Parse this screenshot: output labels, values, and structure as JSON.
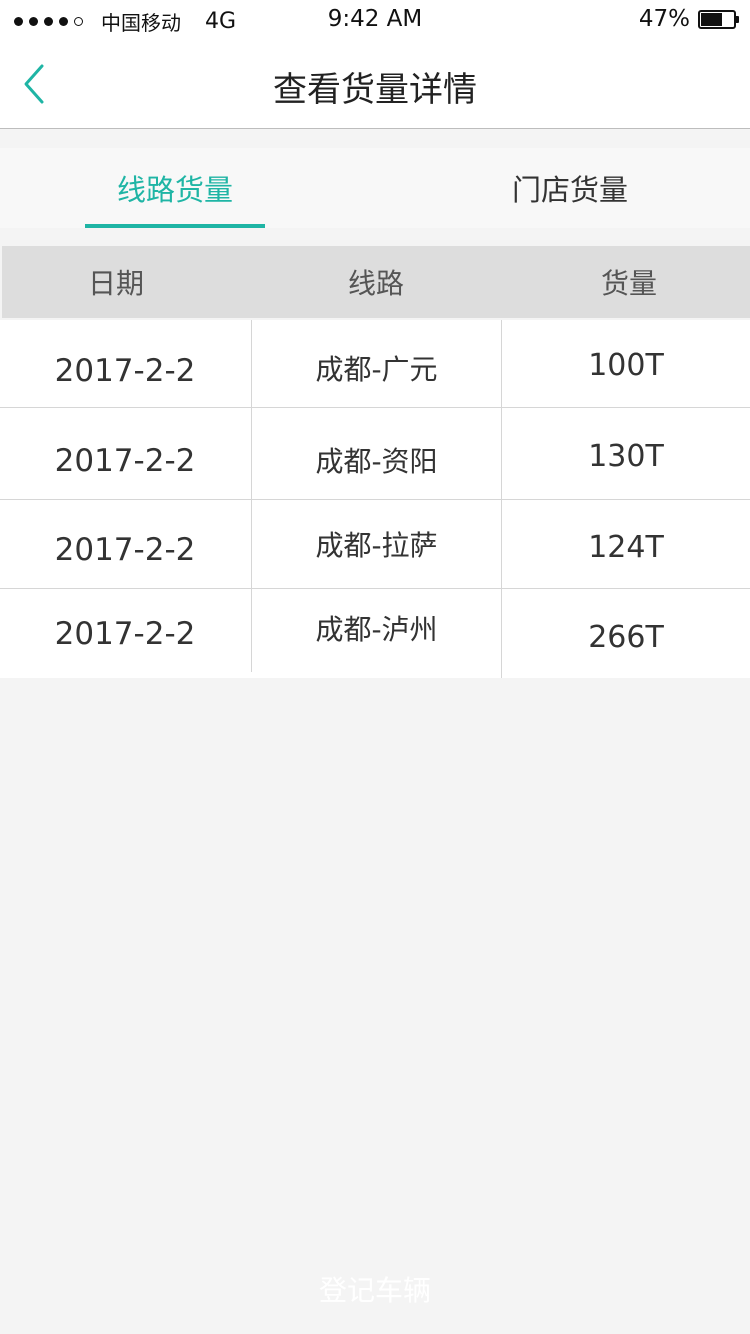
{
  "status_bar": {
    "carrier": "中国移动",
    "network": "4G",
    "time": "9:42 AM",
    "battery_percent": "47%",
    "battery_level": 0.47,
    "signal_strength": 4
  },
  "nav": {
    "title": "查看货量详情",
    "back_icon": "chevron-left-icon",
    "accent_color": "#1fb5a5"
  },
  "tabs": [
    {
      "label": "线路货量",
      "active": true
    },
    {
      "label": "门店货量",
      "active": false
    }
  ],
  "table": {
    "headers": [
      "日期",
      "线路",
      "货量"
    ],
    "rows": [
      {
        "date": "2017-2-2",
        "route": "成都-广元",
        "volume": "100T"
      },
      {
        "date": "2017-2-2",
        "route": "成都-资阳",
        "volume": "130T"
      },
      {
        "date": "2017-2-2",
        "route": "成都-拉萨",
        "volume": "124T"
      },
      {
        "date": "2017-2-2",
        "route": "成都-泸州",
        "volume": "266T"
      }
    ]
  },
  "footer": {
    "register_label": "登记车辆"
  }
}
